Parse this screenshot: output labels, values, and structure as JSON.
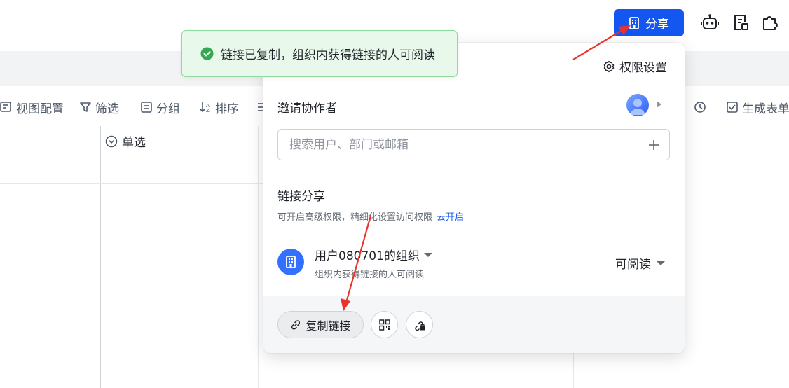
{
  "header": {
    "share_label": "分享",
    "icons": [
      "building-icon",
      "robot-icon",
      "template-icon",
      "plugin-icon"
    ]
  },
  "toolbar": {
    "items": [
      {
        "label": "视图配置",
        "icon": "view-config-icon"
      },
      {
        "label": "筛选",
        "icon": "filter-icon"
      },
      {
        "label": "分组",
        "icon": "group-icon"
      },
      {
        "label": "排序",
        "icon": "sort-icon"
      },
      {
        "label": "生成表单",
        "icon": "form-icon"
      }
    ]
  },
  "grid": {
    "column_header": "单选"
  },
  "toast": {
    "message": "链接已复制，组织内获得链接的人可阅读"
  },
  "share_panel": {
    "permission_settings": "权限设置",
    "invite_title": "邀请协作者",
    "search_placeholder": "搜索用户、部门或邮箱",
    "link_share_title": "链接分享",
    "link_share_desc": "可开启高级权限，精细化设置访问权限",
    "enable_link": "去开启",
    "org_name": "用户080701的组织",
    "org_desc": "组织内获得链接的人可阅读",
    "permission_level": "可阅读",
    "copy_link_label": "复制链接"
  },
  "colors": {
    "primary": "#1456f0",
    "success": "#34a853",
    "annotation_arrow": "#e8322a"
  }
}
